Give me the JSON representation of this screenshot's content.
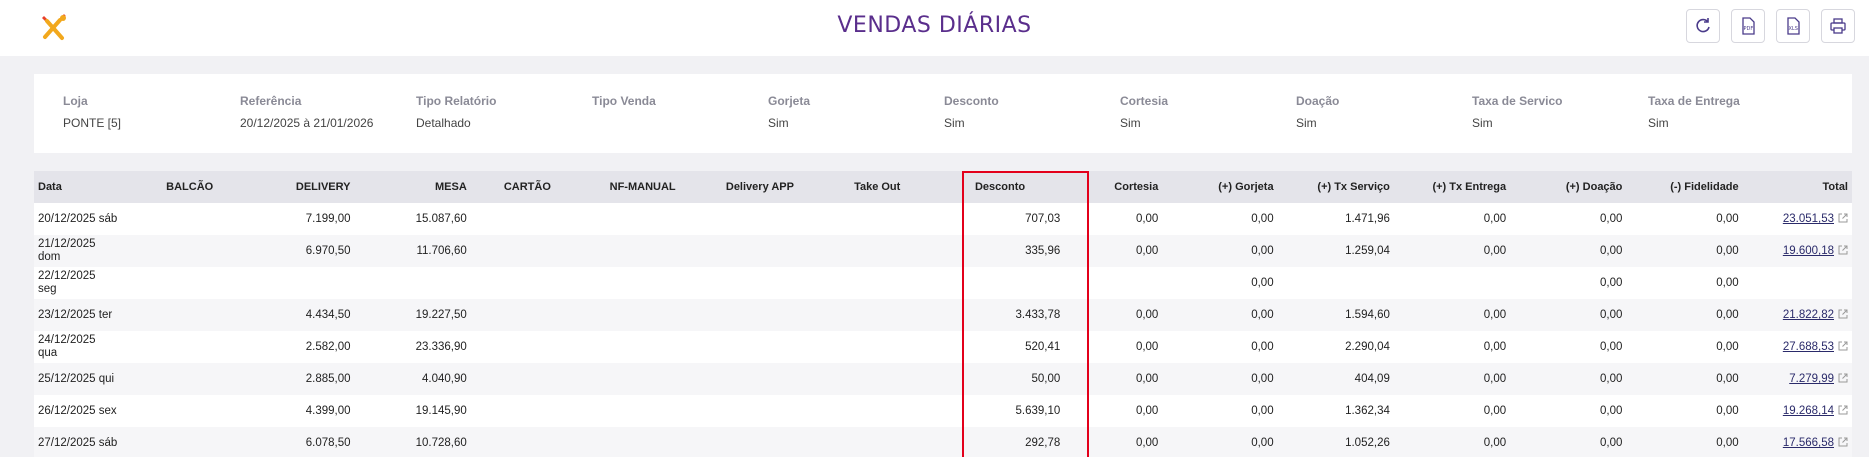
{
  "header": {
    "title": "VENDAS DIÁRIAS",
    "logo_icon": "restaurant-utensils-icon",
    "buttons": [
      {
        "name": "refresh",
        "icon": "refresh-icon"
      },
      {
        "name": "export-pdf",
        "icon": "pdf-file-icon",
        "label": "PDF"
      },
      {
        "name": "export-xls",
        "icon": "xls-file-icon",
        "label": "XLS"
      },
      {
        "name": "print",
        "icon": "printer-icon"
      }
    ]
  },
  "filters": [
    {
      "label": "Loja",
      "value": "PONTE  [5]"
    },
    {
      "label": "Referência",
      "value": "20/12/2025 à 21/01/2026"
    },
    {
      "label": "Tipo Relatório",
      "value": "Detalhado"
    },
    {
      "label": "Tipo Venda",
      "value": ""
    },
    {
      "label": "Gorjeta",
      "value": "Sim"
    },
    {
      "label": "Desconto",
      "value": "Sim"
    },
    {
      "label": "Cortesia",
      "value": "Sim"
    },
    {
      "label": "Doação",
      "value": "Sim"
    },
    {
      "label": "Taxa de Servico",
      "value": "Sim"
    },
    {
      "label": "Taxa de Entrega",
      "value": "Sim"
    }
  ],
  "table": {
    "columns": [
      "Data",
      "BALCÃO",
      "DELIVERY",
      "MESA",
      "CARTÃO",
      "NF-MANUAL",
      "Delivery APP",
      "Take Out",
      "Desconto",
      "Cortesia",
      "(+) Gorjeta",
      "(+) Tx Serviço",
      "(+) Tx Entrega",
      "(+) Doação",
      "(-) Fidelidade",
      "Total"
    ],
    "rows": [
      {
        "date1": "20/12/2025 sáb",
        "date2": "",
        "balcao": "",
        "delivery": "7.199,00",
        "mesa": "15.087,60",
        "cartao": "",
        "nf": "",
        "dapp": "",
        "takeout": "",
        "desconto": "707,03",
        "cortesia": "0,00",
        "gorjeta": "0,00",
        "txserv": "1.471,96",
        "txent": "0,00",
        "doacao": "0,00",
        "fidel": "0,00",
        "total": "23.051,53"
      },
      {
        "date1": "21/12/2025",
        "date2": "dom",
        "balcao": "",
        "delivery": "6.970,50",
        "mesa": "11.706,60",
        "cartao": "",
        "nf": "",
        "dapp": "",
        "takeout": "",
        "desconto": "335,96",
        "cortesia": "0,00",
        "gorjeta": "0,00",
        "txserv": "1.259,04",
        "txent": "0,00",
        "doacao": "0,00",
        "fidel": "0,00",
        "total": "19.600,18"
      },
      {
        "date1": "22/12/2025",
        "date2": "seg",
        "balcao": "",
        "delivery": "",
        "mesa": "",
        "cartao": "",
        "nf": "",
        "dapp": "",
        "takeout": "",
        "desconto": "",
        "cortesia": "",
        "gorjeta": "0,00",
        "txserv": "",
        "txent": "",
        "doacao": "0,00",
        "fidel": "0,00",
        "total": ""
      },
      {
        "date1": "23/12/2025 ter",
        "date2": "",
        "balcao": "",
        "delivery": "4.434,50",
        "mesa": "19.227,50",
        "cartao": "",
        "nf": "",
        "dapp": "",
        "takeout": "",
        "desconto": "3.433,78",
        "cortesia": "0,00",
        "gorjeta": "0,00",
        "txserv": "1.594,60",
        "txent": "0,00",
        "doacao": "0,00",
        "fidel": "0,00",
        "total": "21.822,82"
      },
      {
        "date1": "24/12/2025",
        "date2": "qua",
        "balcao": "",
        "delivery": "2.582,00",
        "mesa": "23.336,90",
        "cartao": "",
        "nf": "",
        "dapp": "",
        "takeout": "",
        "desconto": "520,41",
        "cortesia": "0,00",
        "gorjeta": "0,00",
        "txserv": "2.290,04",
        "txent": "0,00",
        "doacao": "0,00",
        "fidel": "0,00",
        "total": "27.688,53"
      },
      {
        "date1": "25/12/2025 qui",
        "date2": "",
        "balcao": "",
        "delivery": "2.885,00",
        "mesa": "4.040,90",
        "cartao": "",
        "nf": "",
        "dapp": "",
        "takeout": "",
        "desconto": "50,00",
        "cortesia": "0,00",
        "gorjeta": "0,00",
        "txserv": "404,09",
        "txent": "0,00",
        "doacao": "0,00",
        "fidel": "0,00",
        "total": "7.279,99"
      },
      {
        "date1": "26/12/2025 sex",
        "date2": "",
        "balcao": "",
        "delivery": "4.399,00",
        "mesa": "19.145,90",
        "cartao": "",
        "nf": "",
        "dapp": "",
        "takeout": "",
        "desconto": "5.639,10",
        "cortesia": "0,00",
        "gorjeta": "0,00",
        "txserv": "1.362,34",
        "txent": "0,00",
        "doacao": "0,00",
        "fidel": "0,00",
        "total": "19.268,14"
      },
      {
        "date1": "27/12/2025 sáb",
        "date2": "",
        "balcao": "",
        "delivery": "6.078,50",
        "mesa": "10.728,60",
        "cartao": "",
        "nf": "",
        "dapp": "",
        "takeout": "",
        "desconto": "292,78",
        "cortesia": "0,00",
        "gorjeta": "0,00",
        "txserv": "1.052,26",
        "txent": "0,00",
        "doacao": "0,00",
        "fidel": "0,00",
        "total": "17.566,58"
      }
    ]
  },
  "colors": {
    "title": "#5a2e8c",
    "highlight": "#e3001b",
    "header_bg": "#e4e4ea"
  }
}
